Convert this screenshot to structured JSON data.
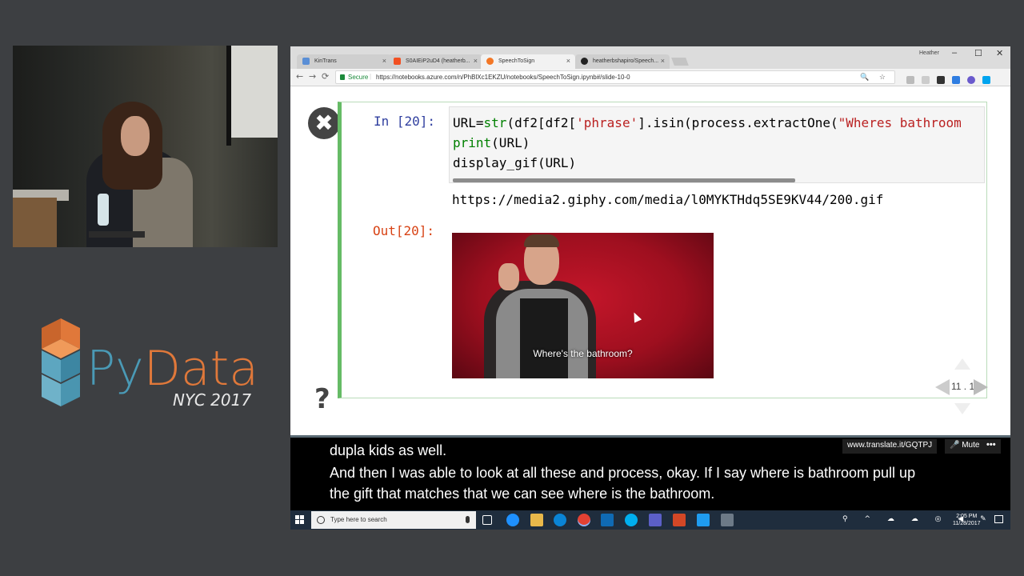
{
  "conference": {
    "logo_py": "Py",
    "logo_data": "Data",
    "subtitle": "NYC 2017",
    "colors": {
      "py": "#4a9ab6",
      "data": "#e0783a"
    }
  },
  "browser": {
    "tabs": [
      {
        "label": "KinTrans",
        "icon": "kintrans-icon",
        "icon_color": "#5b8fd6",
        "active": false
      },
      {
        "label": "S0AIEiP2uD4 (heatherb...",
        "icon": "microsoft-icon",
        "icon_color": "#f25022",
        "active": false
      },
      {
        "label": "SpeechToSign",
        "icon": "jupyter-icon",
        "icon_color": "#f37726",
        "active": true
      },
      {
        "label": "heatherbshapiro/Speech...",
        "icon": "github-icon",
        "icon_color": "#222222",
        "active": false
      }
    ],
    "window_user": "Heather",
    "window_controls": {
      "minimize": "–",
      "maximize": "☐",
      "close": "✕"
    },
    "nav": {
      "back": "←",
      "forward": "→",
      "reload": "⟳"
    },
    "secure_label": "Secure",
    "url": "https://notebooks.azure.com/n/PhBlXc1EKZU/notebooks/SpeechToSign.ipynb#/slide-10-0",
    "address_icons": "🔍 ☆"
  },
  "notebook": {
    "close_glyph": "✖",
    "in_prompt": "In [20]:",
    "out_prompt": "Out[20]:",
    "code": {
      "line1_a": "URL=",
      "line1_b": "str",
      "line1_c": "(df2[df2[",
      "line1_d": "'phrase'",
      "line1_e": "].isin(process.extractOne(",
      "line1_f": "\"Wheres bathroom",
      "line2_a": "print",
      "line2_b": "(URL)",
      "line3": "display_gif(URL)"
    },
    "output_url": "https://media2.giphy.com/media/l0MYKTHdq5SE9KV44/200.gif",
    "gif_caption": "Where's the bathroom?",
    "help_glyph": "?",
    "slide_number": "11 . 1"
  },
  "captions": {
    "line1": "dupla kids as well.",
    "line2": "And then I was able to look at all these and process, okay. If I say where is bathroom pull up",
    "line3": "the gift that matches that we can see where is the bathroom.",
    "link": "www.translate.it/GQTPJ",
    "mute_label": "🎤 Mute",
    "more": "•••"
  },
  "taskbar": {
    "search_placeholder": "Type here to search",
    "time": "2:05 PM",
    "date": "11/28/2017",
    "tray_glyphs": "⚲ ^ ☁ ☁ ◎ ◀ ✎"
  }
}
